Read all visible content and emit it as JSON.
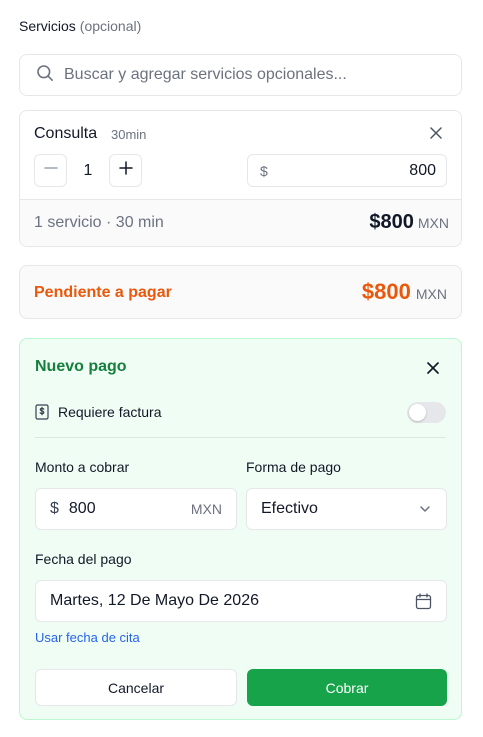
{
  "services": {
    "label": "Servicios",
    "optional": "(opcional)",
    "search_placeholder": "Buscar y agregar servicios opcionales...",
    "items": [
      {
        "name": "Consulta",
        "duration": "30min",
        "quantity": "1",
        "currency_symbol": "$",
        "price": "800"
      }
    ],
    "summary": "1 servicio · 30 min",
    "total": "$800",
    "total_unit": "MXN"
  },
  "pending": {
    "label": "Pendiente a pagar",
    "amount": "$800",
    "unit": "MXN"
  },
  "payment": {
    "title": "Nuevo pago",
    "invoice_label": "Requiere factura",
    "invoice_required": false,
    "amount_label": "Monto a cobrar",
    "amount_currency": "$",
    "amount_value": "800",
    "amount_unit": "MXN",
    "method_label": "Forma de pago",
    "method_value": "Efectivo",
    "date_label": "Fecha del pago",
    "date_value": "Martes, 12 De Mayo De 2026",
    "use_appointment_date": "Usar fecha de cita",
    "cancel_label": "Cancelar",
    "charge_label": "Cobrar"
  },
  "colors": {
    "accent_green": "#16a34a",
    "title_green": "#15803d",
    "pending_orange": "#ea580c",
    "link_blue": "#2563eb"
  },
  "icons": {
    "search": "search-icon",
    "close": "close-icon",
    "minus": "minus-icon",
    "plus": "plus-icon",
    "invoice": "invoice-dollar-icon",
    "chevron": "chevron-down-icon",
    "calendar": "calendar-icon"
  }
}
